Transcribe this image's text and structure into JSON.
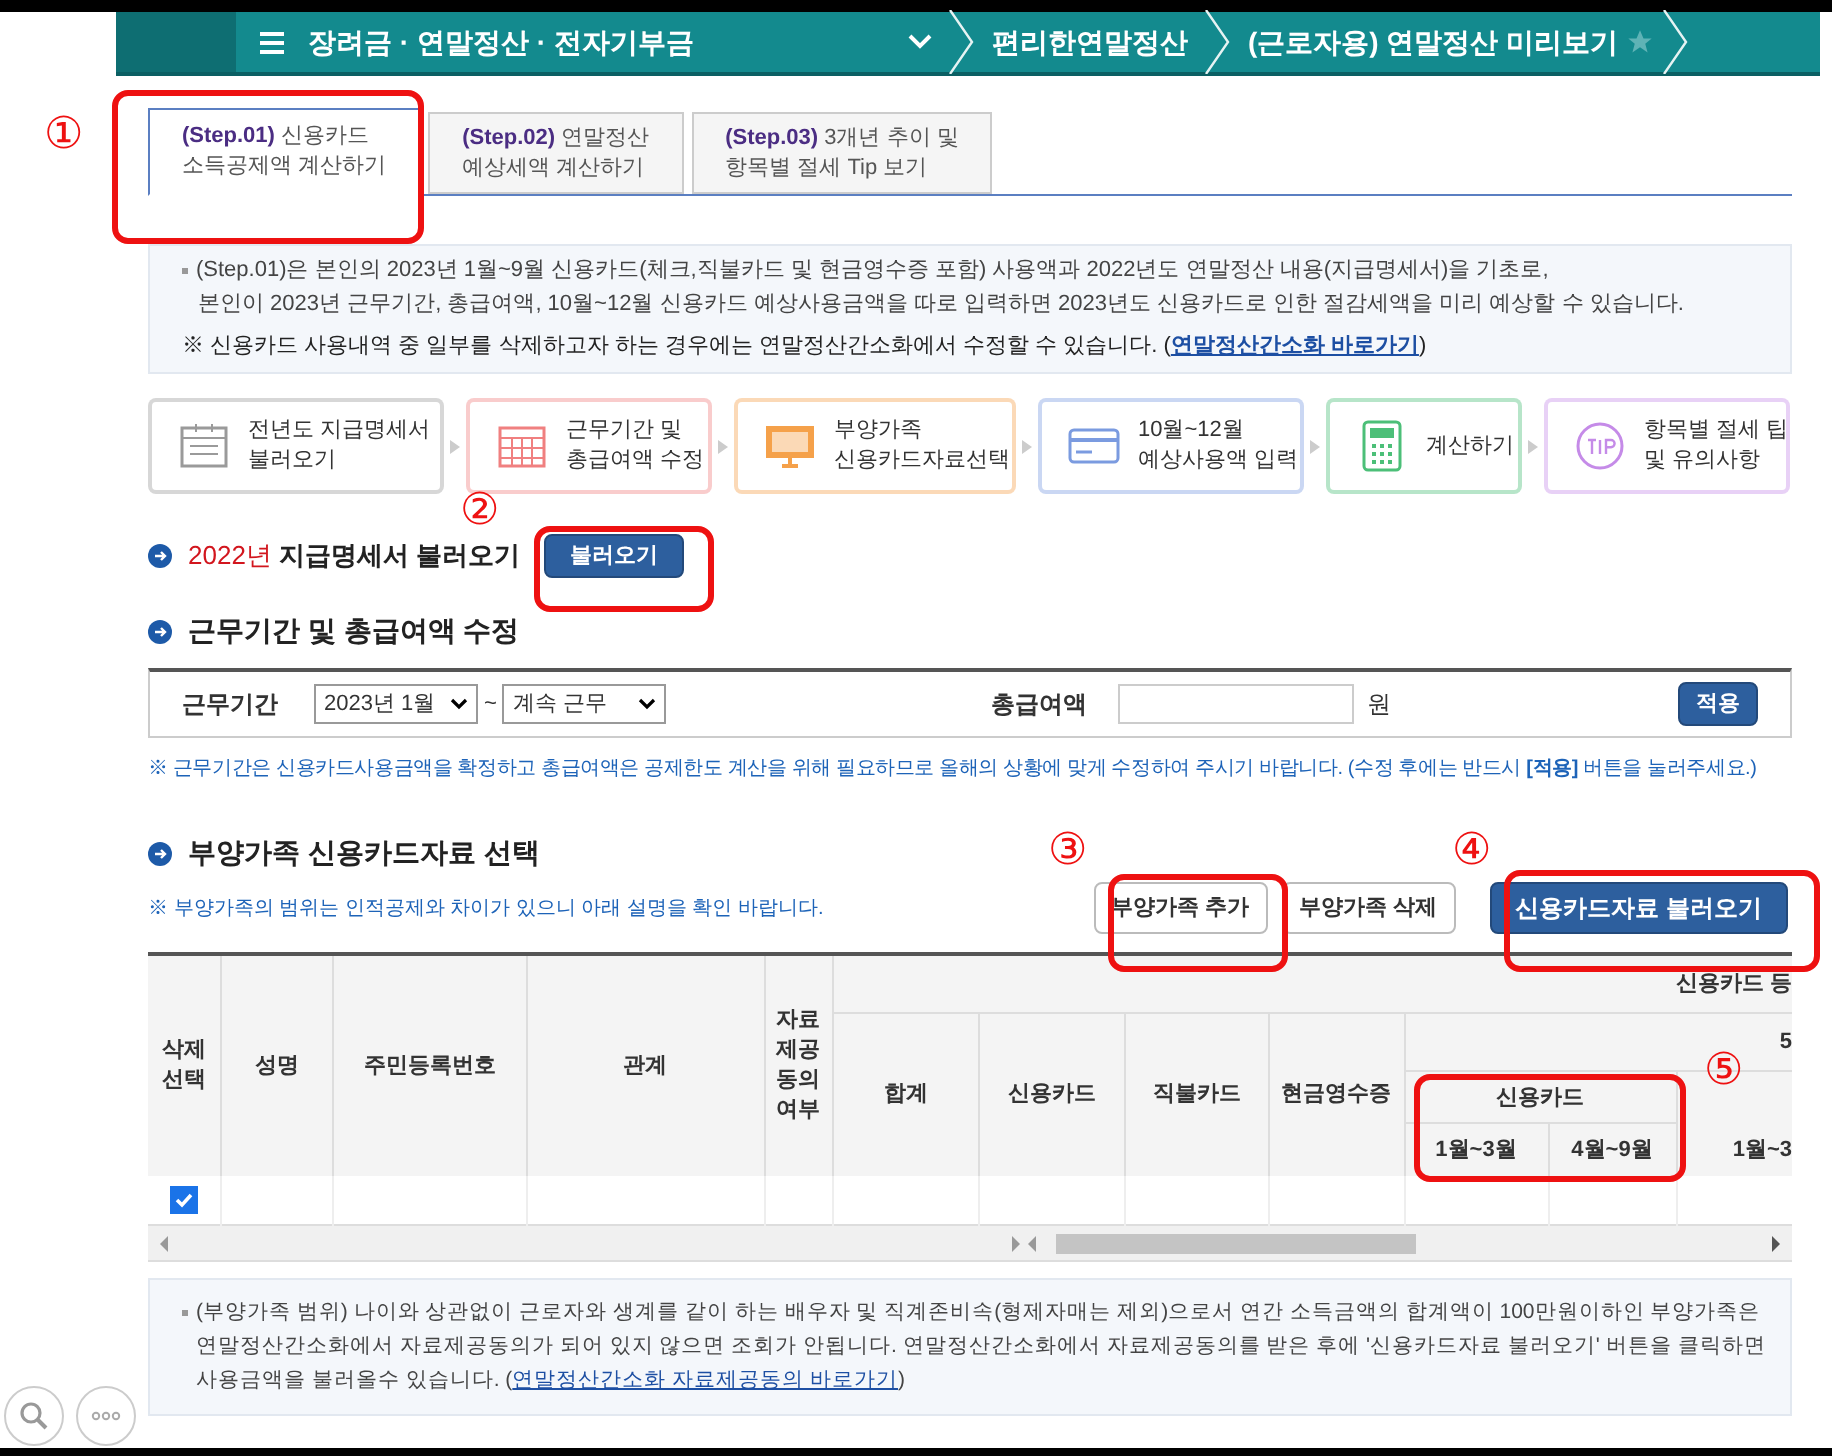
{
  "nav": {
    "menu": "장려금 · 연말정산 · 전자기부금",
    "crumbs": [
      "편리한연말정산",
      "(근로자용) 연말정산 미리보기"
    ],
    "favorite": false
  },
  "tabs": [
    {
      "step": "(Step.01)",
      "lines": [
        "신용카드",
        "소득공제액 계산하기"
      ],
      "selected": true
    },
    {
      "step": "(Step.02)",
      "lines": [
        "연말정산",
        "예상세액 계산하기"
      ],
      "selected": false
    },
    {
      "step": "(Step.03)",
      "lines": [
        "3개년 추이 및",
        "항목별 절세 Tip 보기"
      ],
      "selected": false
    }
  ],
  "info": {
    "lines": [
      "(Step.01)은 본인의 2023년 1월~9월 신용카드(체크,직불카드 및 현금영수증 포함) 사용액과 2022년도 연말정산 내용(지급명세서)을 기초로,",
      "본인이 2023년 근무기간, 총급여액, 10월~12월 신용카드 예상사용금액을 따로 입력하면 2023년도 신용카드로 인한 절감세액을 미리 예상할 수 있습니다."
    ],
    "note": "※ 신용카드 사용내역 중 일부를 삭제하고자 하는 경우에는 연말정산간소화에서 수정할 수 있습니다. (",
    "link": "연말정산간소화 바로가기",
    "note_end": ")"
  },
  "steps": [
    {
      "lines": [
        "전년도 지급명세서",
        "불러오기"
      ],
      "color": "#9a9a9a"
    },
    {
      "lines": [
        "근무기간 및",
        "총급여액 수정"
      ],
      "color": "#f08080"
    },
    {
      "lines": [
        "부양가족",
        "신용카드자료선택"
      ],
      "color": "#f5a14a"
    },
    {
      "lines": [
        "10월~12월",
        "예상사용액 입력"
      ],
      "color": "#7b9be0"
    },
    {
      "lines": [
        "계산하기"
      ],
      "color": "#4cbf78"
    },
    {
      "lines": [
        "항목별 절세 팁",
        "및 유의사항"
      ],
      "color": "#c58be8"
    }
  ],
  "load_section": {
    "year": "2022년",
    "title": "지급명세서 불러오기",
    "button": "불러오기"
  },
  "period_section": {
    "title": "근무기간 및 총급여액 수정",
    "period_label": "근무기간",
    "start": "2023년 1월",
    "tilde": "~",
    "end": "계속 근무",
    "salary_label": "총급여액",
    "unit": "원",
    "apply": "적용",
    "note": "※ 근무기간은 신용카드사용금액을 확정하고 총급여액은 공제한도 계산을 위해 필요하므로 올해의 상황에 맞게 수정하여 주시기 바랍니다. (수정 후에는 반드시 **[적용]** 버튼을 눌러주세요.)"
  },
  "family_section": {
    "title": "부양가족 신용카드자료 선택",
    "note": "※ 부양가족의 범위는 인적공제와 차이가 있으니 아래 설명을 확인 바랍니다.",
    "buttons": [
      "부양가족 추가",
      "부양가족 삭제",
      "신용카드자료 불러오기"
    ]
  },
  "table": {
    "columns": [
      "삭제\n선택",
      "성명",
      "주민등록번호",
      "관계",
      "자료\n제공\n동의\n여부",
      "합계",
      "신용카드",
      "직불카드",
      "현금영수증"
    ],
    "group_1": "신용카드 등",
    "group_2": "5",
    "group_3": "신용카드",
    "sub_columns": [
      "1월~3월",
      "4월~9월",
      "1월~3"
    ],
    "rows": [
      {
        "checked": true
      }
    ]
  },
  "footer": {
    "text": "(부양가족 범위) 나이와 상관없이 근로자와 생계를 같이 하는 배우자 및 직계존비속(형제자매는 제외)으로서 연간 소득금액의 합계액이 100만원이하인 부양가족은 연말정산간소화에서 자료제공동의가 되어 있지 않으면 조회가 안됩니다. 연말정산간소화에서 자료제공동의를 받은 후에 '신용카드자료 불러오기' 버튼을 클릭하면 사용금액을 불러올수 있습니다. (",
    "link": "연말정산간소화 자료제공동의 바로가기",
    "end": ")"
  },
  "annotations": [
    "①",
    "②",
    "③",
    "④",
    "⑤"
  ]
}
